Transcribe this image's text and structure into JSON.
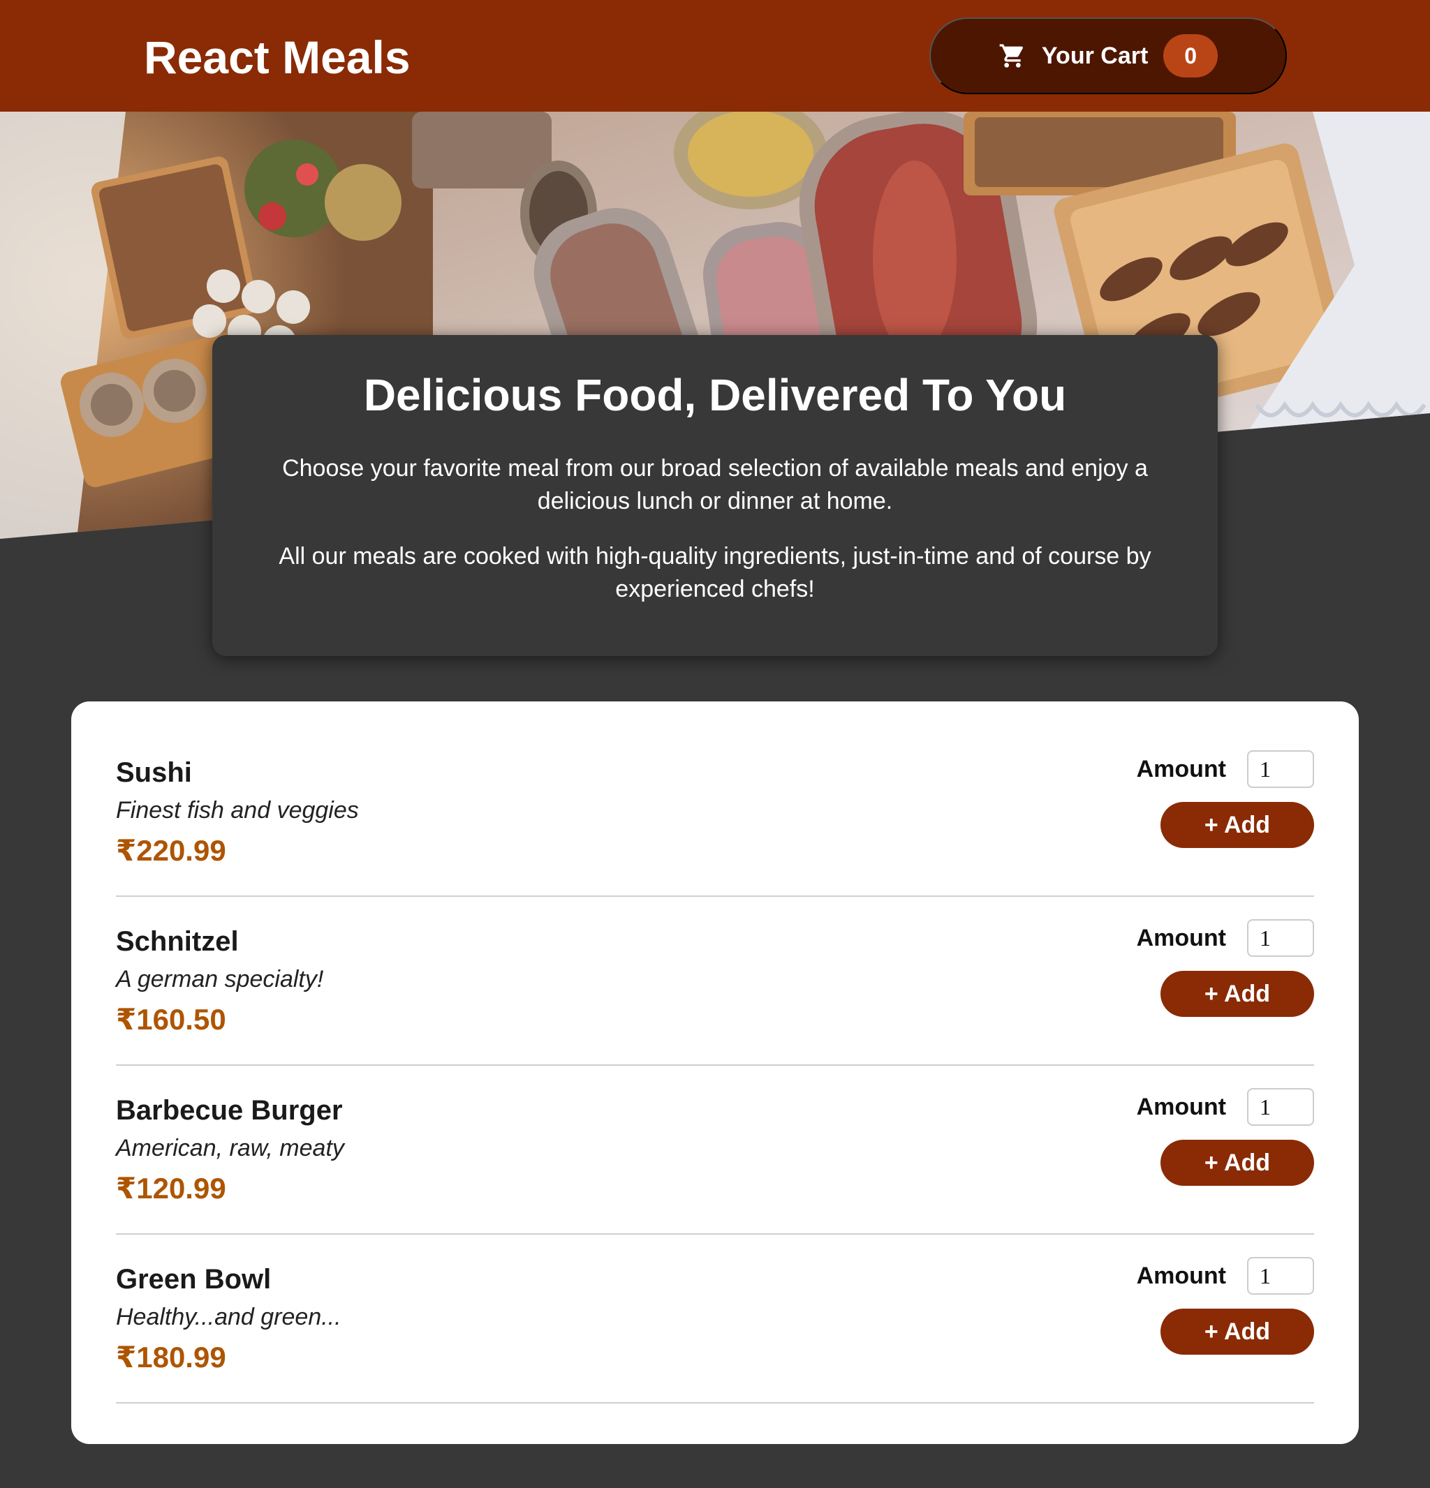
{
  "header": {
    "title": "React Meals",
    "cart": {
      "icon": "cart-icon",
      "label": "Your Cart",
      "count": "0"
    }
  },
  "summary": {
    "title": "Delicious Food, Delivered To You",
    "paragraph1": "Choose your favorite meal from our broad selection of available meals and enjoy a delicious lunch or dinner at home.",
    "paragraph2": "All our meals are cooked with high-quality ingredients, just-in-time and of course by experienced chefs!"
  },
  "meals": [
    {
      "name": "Sushi",
      "description": "Finest fish and veggies",
      "price": "₹220.99",
      "amount_label": "Amount",
      "amount_value": "1",
      "add_label": "+ Add"
    },
    {
      "name": "Schnitzel",
      "description": "A german specialty!",
      "price": "₹160.50",
      "amount_label": "Amount",
      "amount_value": "1",
      "add_label": "+ Add"
    },
    {
      "name": "Barbecue Burger",
      "description": "American, raw, meaty",
      "price": "₹120.99",
      "amount_label": "Amount",
      "amount_value": "1",
      "add_label": "+ Add"
    },
    {
      "name": "Green Bowl",
      "description": "Healthy...and green...",
      "price": "₹180.99",
      "amount_label": "Amount",
      "amount_value": "1",
      "add_label": "+ Add"
    }
  ],
  "colors": {
    "header": "#8a2b06",
    "cart_button": "#4d1601",
    "cart_badge": "#b94517",
    "page_background": "#383838",
    "price": "#ad5502",
    "add_button": "#8a2b06"
  }
}
